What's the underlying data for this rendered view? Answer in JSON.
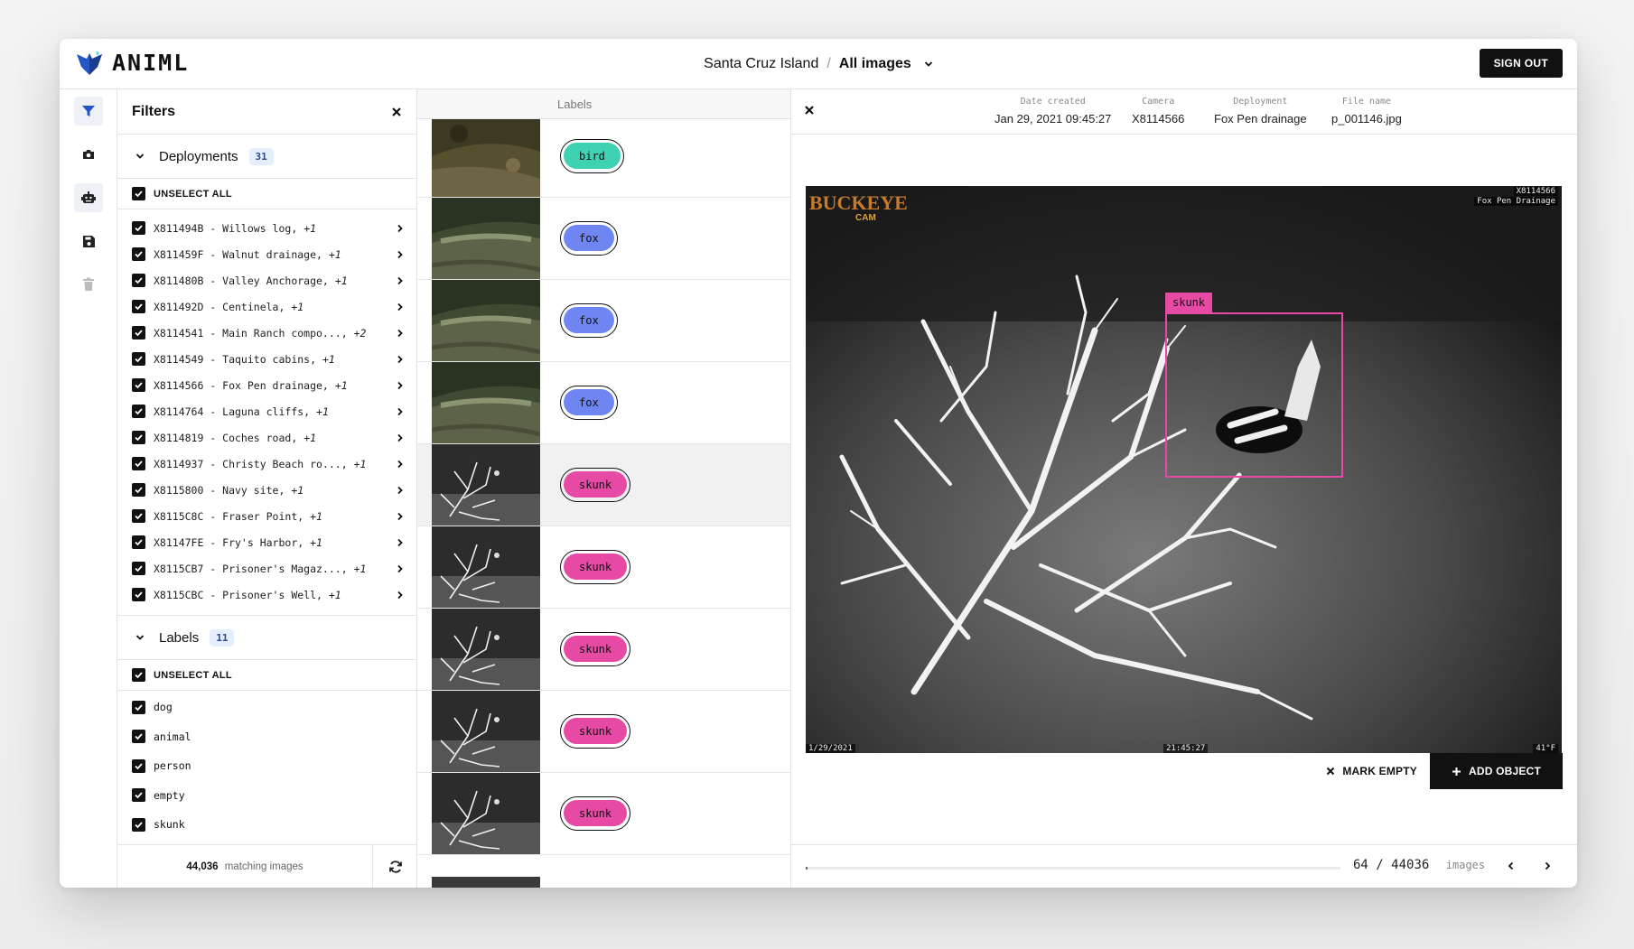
{
  "app": {
    "name": "ANIML"
  },
  "header": {
    "project": "Santa Cruz Island",
    "separator": "/",
    "view": "All images",
    "sign_out": "SIGN OUT"
  },
  "rail": {
    "icons": [
      "filter-icon",
      "camera-icon",
      "robot-icon",
      "save-icon",
      "trash-icon"
    ]
  },
  "filters": {
    "title": "Filters",
    "deployments": {
      "title": "Deployments",
      "count": "31",
      "unselect_all": "UNSELECT ALL",
      "items": [
        {
          "name": "X811494B - Willows log,",
          "extra": "+1"
        },
        {
          "name": "X811459F - Walnut drainage,",
          "extra": "+1"
        },
        {
          "name": "X811480B - Valley Anchorage,",
          "extra": "+1"
        },
        {
          "name": "X811492D - Centinela,",
          "extra": "+1"
        },
        {
          "name": "X8114541 - Main Ranch compo...,",
          "extra": "+2"
        },
        {
          "name": "X8114549 - Taquito cabins,",
          "extra": "+1"
        },
        {
          "name": "X8114566 - Fox Pen drainage,",
          "extra": "+1"
        },
        {
          "name": "X8114764 - Laguna cliffs,",
          "extra": "+1"
        },
        {
          "name": "X8114819 - Coches road,",
          "extra": "+1"
        },
        {
          "name": "X8114937 - Christy Beach ro...,",
          "extra": "+1"
        },
        {
          "name": "X8115800 - Navy site,",
          "extra": "+1"
        },
        {
          "name": "X8115C8C - Fraser Point,",
          "extra": "+1"
        },
        {
          "name": "X81147FE - Fry's Harbor,",
          "extra": "+1"
        },
        {
          "name": "X8115CB7 - Prisoner's Magaz...,",
          "extra": "+1"
        },
        {
          "name": "X8115CBC - Prisoner's Well,",
          "extra": "+1"
        }
      ]
    },
    "labels": {
      "title": "Labels",
      "count": "11",
      "unselect_all": "UNSELECT ALL",
      "items": [
        "dog",
        "animal",
        "person",
        "empty",
        "skunk"
      ]
    },
    "footer": {
      "count": "44,036",
      "text": "matching images"
    }
  },
  "image_list": {
    "header": "Labels",
    "rows": [
      {
        "label": "bird",
        "color": "#3ed1b2"
      },
      {
        "label": "fox",
        "color": "#6f86f2"
      },
      {
        "label": "fox",
        "color": "#6f86f2"
      },
      {
        "label": "fox",
        "color": "#6f86f2"
      },
      {
        "label": "skunk",
        "color": "#e64aa4"
      },
      {
        "label": "skunk",
        "color": "#e64aa4"
      },
      {
        "label": "skunk",
        "color": "#e64aa4"
      },
      {
        "label": "skunk",
        "color": "#e64aa4"
      },
      {
        "label": "skunk",
        "color": "#e64aa4"
      }
    ]
  },
  "detail": {
    "meta": [
      {
        "key": "Date created",
        "value": "Jan 29, 2021 09:45:27"
      },
      {
        "key": "Camera",
        "value": "X8114566"
      },
      {
        "key": "Deployment",
        "value": "Fox Pen drainage"
      },
      {
        "key": "File name",
        "value": "p_001146.jpg"
      }
    ],
    "image": {
      "brand": "BUCKEYE",
      "brand_sub": "CAM",
      "stamp_tr_1": "X8114566",
      "stamp_tr_2": "Fox Pen Drainage",
      "stamp_bl": "1/29/2021",
      "stamp_bc": "21:45:27",
      "stamp_br": "41°F",
      "object_label": "skunk",
      "object_color": "#e64aa4"
    },
    "mark_empty": "MARK EMPTY",
    "add_object": "ADD OBJECT"
  },
  "pager": {
    "current": "64",
    "sep": "/",
    "total": "44036",
    "unit": "images",
    "progress": 0.0015
  }
}
